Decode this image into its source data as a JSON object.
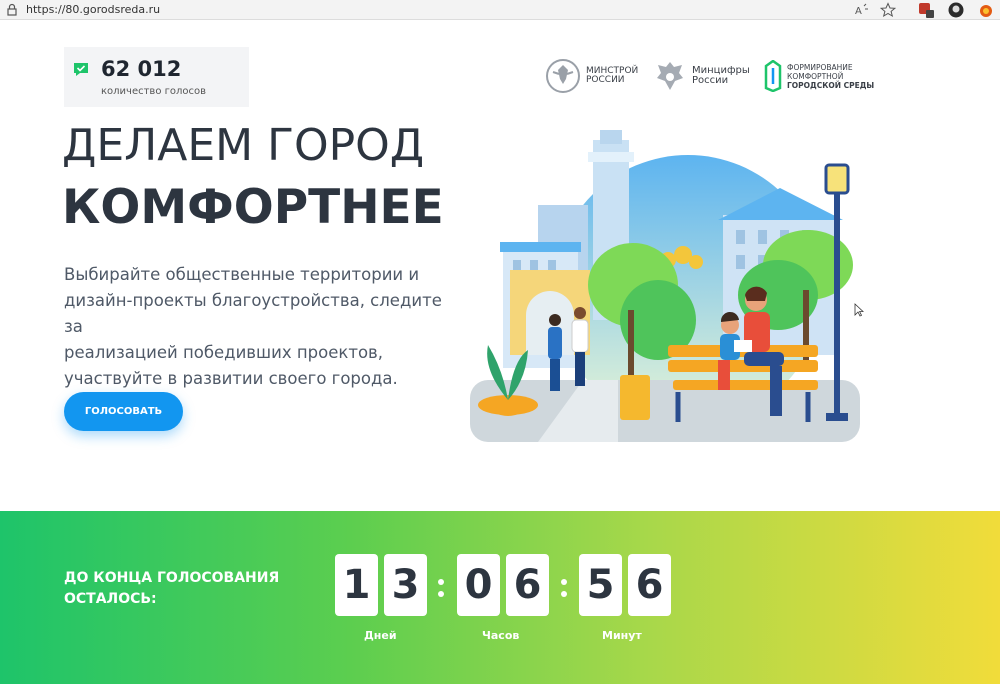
{
  "browser": {
    "url": "https://80.gorodsreda.ru"
  },
  "tracker": {
    "count": "62 012",
    "label": "количество голосов"
  },
  "logos": [
    {
      "name": "minstroy",
      "line1": "МИНСТРОЙ",
      "line2": "РОССИИ"
    },
    {
      "name": "mintsifry",
      "line1": "Минцифры",
      "line2": "России"
    },
    {
      "name": "fks",
      "line1": "ФОРМИРОВАНИЕ",
      "line2": "КОМФОРТНОЙ",
      "line3": "ГОРОДСКОЙ СРЕДЫ"
    }
  ],
  "hero": {
    "title_line1": "ДЕЛАЕМ ГОРОД",
    "title_line2": "КОМФОРТНЕЕ",
    "desc_line1": "Выбирайте общественные территории и",
    "desc_line2": "дизайн-проекты благоустройства, следите за",
    "desc_line3": "реализацией победивших проектов,",
    "desc_line4": "участвуйте в развитии своего города.",
    "vote_label": "ГОЛОСОВАТЬ"
  },
  "countdown": {
    "label_line1": "ДО КОНЦА ГОЛОСОВАНИЯ",
    "label_line2": "ОСТАЛОСЬ:",
    "days": [
      "1",
      "3"
    ],
    "hours": [
      "0",
      "6"
    ],
    "minutes": [
      "5",
      "6"
    ],
    "days_label": "Дней",
    "hours_label": "Часов",
    "minutes_label": "Минут"
  },
  "colors": {
    "accent": "#1296f0",
    "check": "#1ec46a",
    "gradient_start": "#1ec46a",
    "gradient_end": "#f1dc3a"
  },
  "icons": [
    "lock-icon",
    "read-aloud-icon",
    "favorite-star-icon",
    "extension-icon",
    "profile-icon",
    "check-icon"
  ]
}
